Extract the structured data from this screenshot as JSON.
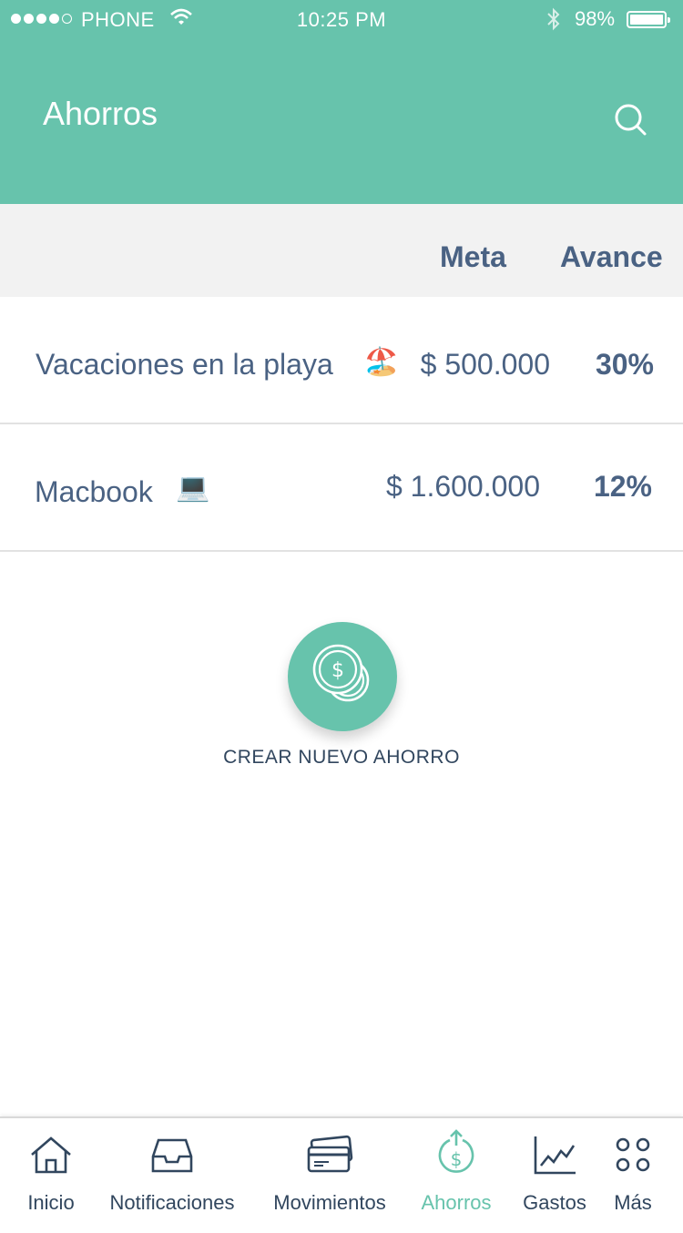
{
  "status_bar": {
    "carrier": "PHONE",
    "time": "10:25 PM",
    "battery_percent": "98%",
    "signal_strength": 4,
    "icons": [
      "wifi-icon",
      "bluetooth-icon",
      "battery-icon"
    ]
  },
  "header": {
    "title": "Ahorros",
    "search_icon": "search-icon",
    "background_color": "#67c3ac"
  },
  "columns": {
    "meta": "Meta",
    "avance": "Avance"
  },
  "savings": [
    {
      "name": "Vacaciones en la playa",
      "emoji": "🏖️",
      "amount": "$ 500.000",
      "progress": "30%"
    },
    {
      "name": "Macbook",
      "emoji": "💻",
      "amount": "$ 1.600.000",
      "progress": "12%"
    }
  ],
  "create": {
    "label": "CREAR NUEVO AHORRO",
    "icon": "coins-icon"
  },
  "tabbar": {
    "active_color": "#67c3ac",
    "items": [
      {
        "label": "Inicio",
        "icon": "home-icon"
      },
      {
        "label": "Notificaciones",
        "icon": "inbox-icon"
      },
      {
        "label": "Movimientos",
        "icon": "cards-icon"
      },
      {
        "label": "Ahorros",
        "icon": "savings-icon"
      },
      {
        "label": "Gastos",
        "icon": "chart-icon"
      },
      {
        "label": "Más",
        "icon": "more-icon"
      }
    ]
  }
}
